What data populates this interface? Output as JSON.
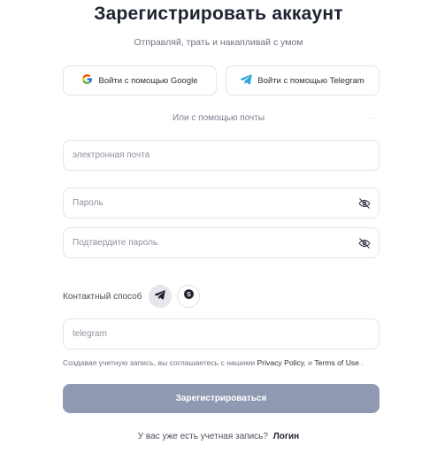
{
  "header": {
    "title": "Зарегистрировать аккаунт",
    "subtitle": "Отправляй, трать и накапливай с умом"
  },
  "social": {
    "google_label": "Войти с помощью Google",
    "telegram_label": "Войти с помощью Telegram",
    "divider_text": "Или с помощью почты"
  },
  "form": {
    "email_placeholder": "электронная почта",
    "password_placeholder": "Пароль",
    "confirm_placeholder": "Подтвердите пароль",
    "contact_label": "Контактный способ",
    "contact_placeholder": "telegram",
    "contact_options": [
      "telegram-icon",
      "skype-icon"
    ],
    "contact_selected": "telegram"
  },
  "terms": {
    "prefix": "Создавая учетную запись, вы соглашаетесь с нашими",
    "privacy": "Privacy Policy",
    "and": ", и",
    "tos": "Terms of Use",
    "suffix": "."
  },
  "submit_label": "Зарегистрироваться",
  "footer": {
    "question": "У вас уже есть учетная запись?",
    "login_link": "Логин"
  },
  "colors": {
    "submit_bg": "#8f9ab2",
    "telegram_blue": "#2aa3df",
    "text_dark": "#1d2230"
  }
}
